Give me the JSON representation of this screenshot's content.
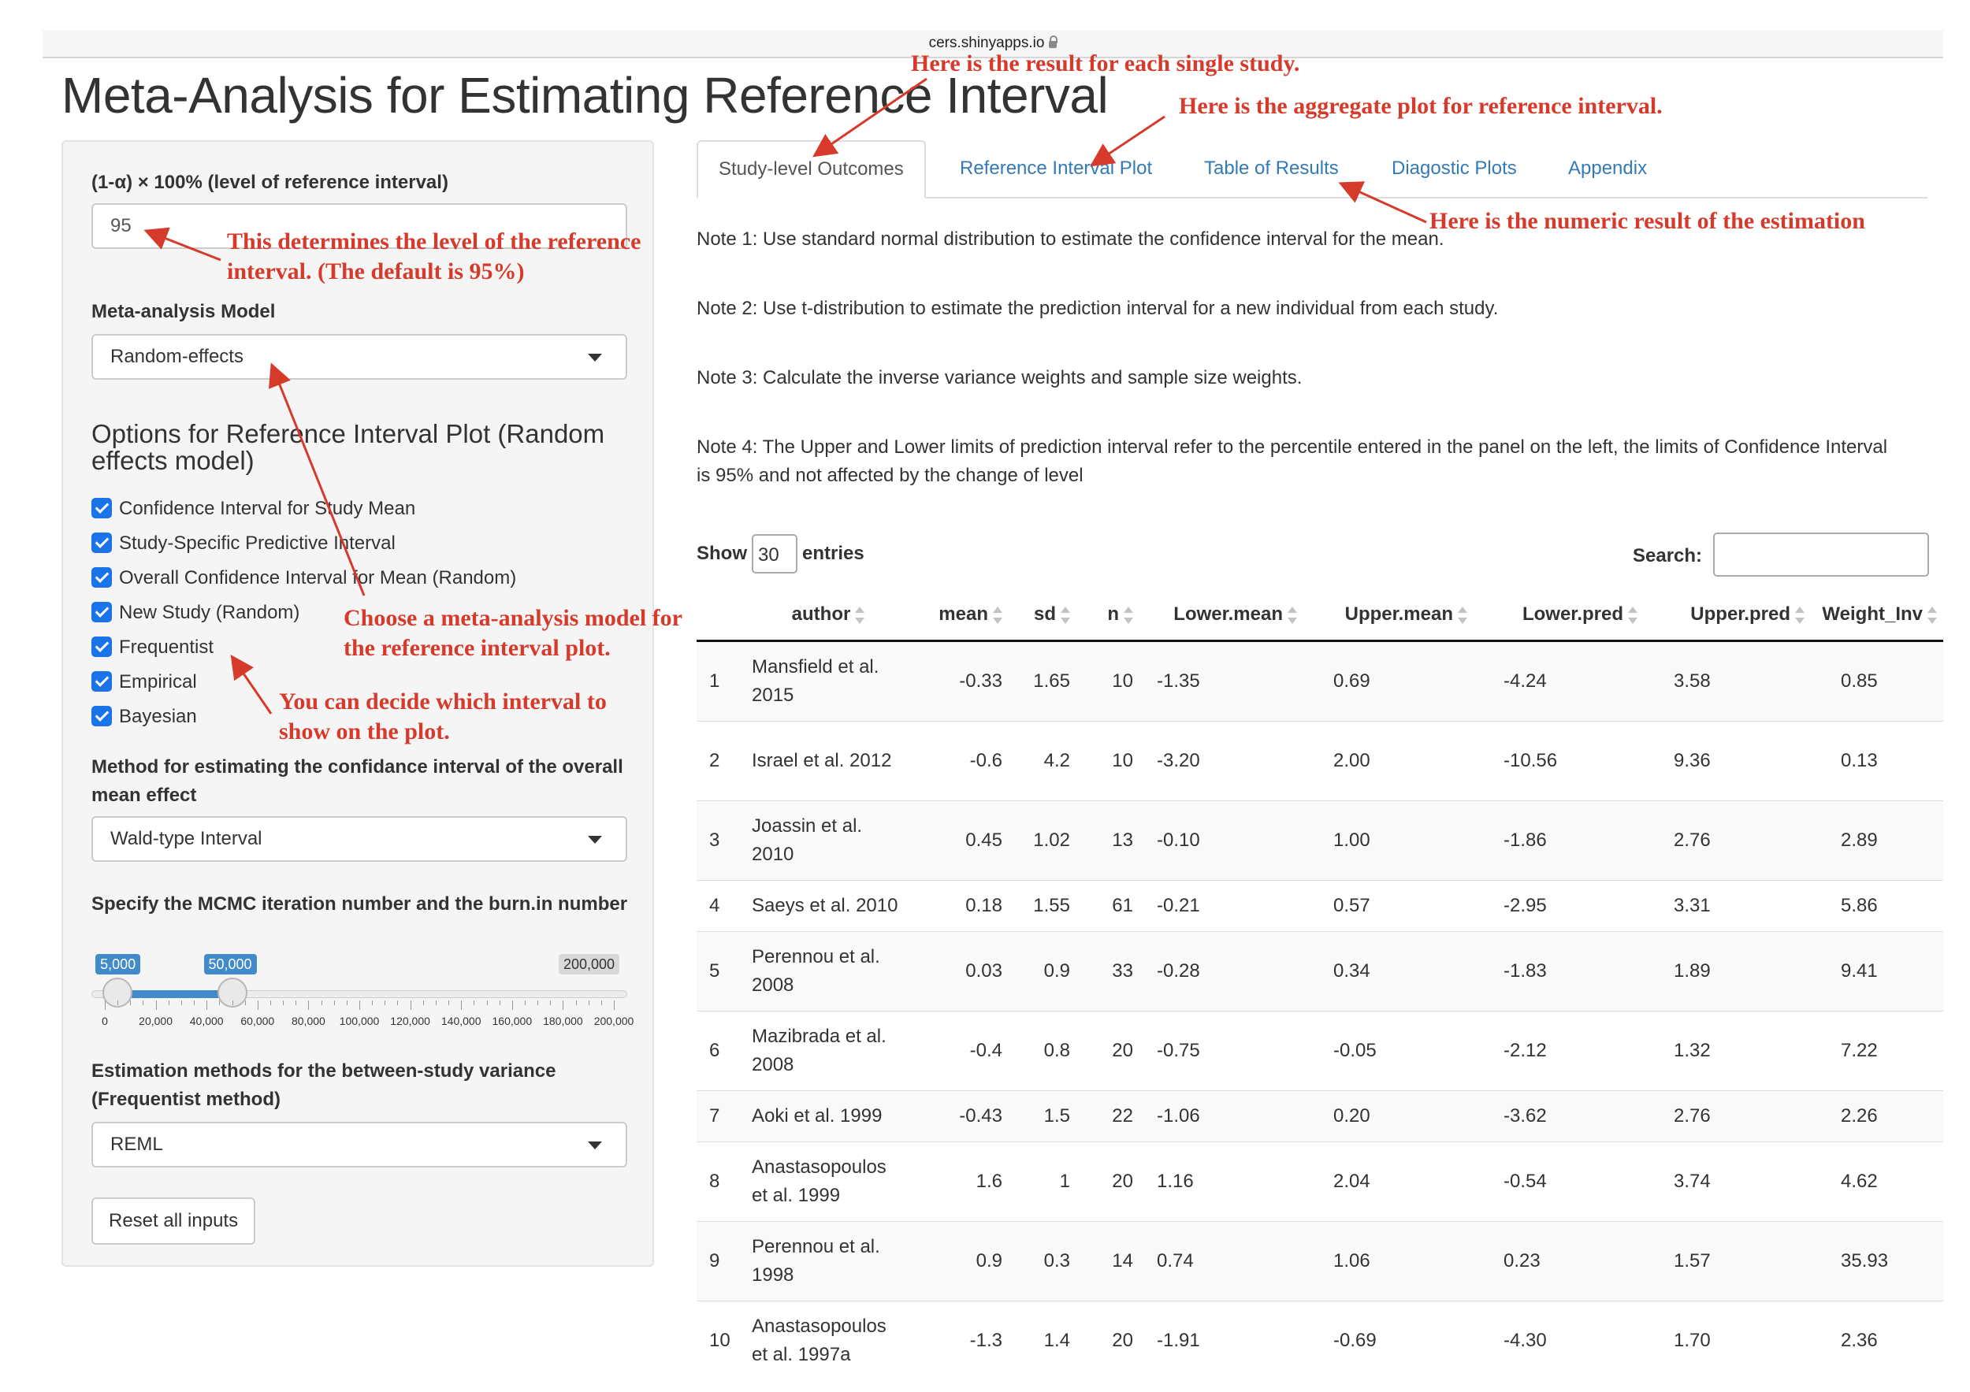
{
  "browser": {
    "url": "cers.shinyapps.io"
  },
  "page_title": "Meta-Analysis for Estimating Reference Interval",
  "sidebar": {
    "level_label": "(1-α) × 100% (level of reference interval)",
    "level_value": "95",
    "model_label": "Meta-analysis Model",
    "model_value": "Random-effects",
    "options_heading": "Options for Reference Interval Plot (Random effects model)",
    "checkboxes": [
      "Confidence Interval for Study Mean",
      "Study-Specific Predictive Interval",
      "Overall Confidence Interval for Mean (Random)",
      "New Study (Random)",
      "Frequentist",
      "Empirical",
      "Bayesian"
    ],
    "method_label": "Method for estimating the confidance interval of the overall mean effect",
    "method_value": "Wald-type Interval",
    "mcmc_label": "Specify the MCMC iteration number and the burn.in number",
    "slider": {
      "min_badge": "5,000",
      "value_badge": "50,000",
      "max_badge": "200,000",
      "low_value": 5000,
      "high_value": 50000,
      "max_value": 200000,
      "ticks": [
        "0",
        "20,000",
        "40,000",
        "60,000",
        "80,000",
        "100,000",
        "120,000",
        "140,000",
        "160,000",
        "180,000",
        "200,000"
      ]
    },
    "variance_label": "Estimation methods for the between-study variance (Frequentist method)",
    "variance_value": "REML",
    "reset_label": "Reset all inputs"
  },
  "tabs": [
    "Study-level Outcomes",
    "Reference Interval Plot",
    "Table of Results",
    "Diagostic Plots",
    "Appendix"
  ],
  "notes": [
    "Note 1: Use standard normal distribution to estimate the confidence interval for the mean.",
    "Note 2: Use t-distribution to estimate the prediction interval for a new individual from each study.",
    "Note 3: Calculate the inverse variance weights and sample size weights.",
    "Note 4: The Upper and Lower limits of prediction interval refer to the percentile entered in the panel on the left, the limits of Confidence Interval is 95% and not affected by the change of level"
  ],
  "table": {
    "show_label": "Show",
    "entries_value": "30",
    "entries_label": "entries",
    "search_label": "Search:",
    "columns": [
      "author",
      "mean",
      "sd",
      "n",
      "Lower.mean",
      "Upper.mean",
      "Lower.pred",
      "Upper.pred",
      "Weight_Inv"
    ],
    "rows": [
      {
        "idx": "1",
        "author": "Mansfield et al. 2015",
        "mean": "-0.33",
        "sd": "1.65",
        "n": "10",
        "lower_mean": "-1.35",
        "upper_mean": "0.69",
        "lower_pred": "-4.24",
        "upper_pred": "3.58",
        "weight": "0.85"
      },
      {
        "idx": "2",
        "author": "Israel et al. 2012",
        "mean": "-0.6",
        "sd": "4.2",
        "n": "10",
        "lower_mean": "-3.20",
        "upper_mean": "2.00",
        "lower_pred": "-10.56",
        "upper_pred": "9.36",
        "weight": "0.13"
      },
      {
        "idx": "3",
        "author": "Joassin et al. 2010",
        "mean": "0.45",
        "sd": "1.02",
        "n": "13",
        "lower_mean": "-0.10",
        "upper_mean": "1.00",
        "lower_pred": "-1.86",
        "upper_pred": "2.76",
        "weight": "2.89"
      },
      {
        "idx": "4",
        "author": "Saeys et al. 2010",
        "mean": "0.18",
        "sd": "1.55",
        "n": "61",
        "lower_mean": "-0.21",
        "upper_mean": "0.57",
        "lower_pred": "-2.95",
        "upper_pred": "3.31",
        "weight": "5.86"
      },
      {
        "idx": "5",
        "author": "Perennou et al. 2008",
        "mean": "0.03",
        "sd": "0.9",
        "n": "33",
        "lower_mean": "-0.28",
        "upper_mean": "0.34",
        "lower_pred": "-1.83",
        "upper_pred": "1.89",
        "weight": "9.41"
      },
      {
        "idx": "6",
        "author": "Mazibrada et al. 2008",
        "mean": "-0.4",
        "sd": "0.8",
        "n": "20",
        "lower_mean": "-0.75",
        "upper_mean": "-0.05",
        "lower_pred": "-2.12",
        "upper_pred": "1.32",
        "weight": "7.22"
      },
      {
        "idx": "7",
        "author": "Aoki et al. 1999",
        "mean": "-0.43",
        "sd": "1.5",
        "n": "22",
        "lower_mean": "-1.06",
        "upper_mean": "0.20",
        "lower_pred": "-3.62",
        "upper_pred": "2.76",
        "weight": "2.26"
      },
      {
        "idx": "8",
        "author": "Anastasopoulos et al. 1999",
        "mean": "1.6",
        "sd": "1",
        "n": "20",
        "lower_mean": "1.16",
        "upper_mean": "2.04",
        "lower_pred": "-0.54",
        "upper_pred": "3.74",
        "weight": "4.62"
      },
      {
        "idx": "9",
        "author": "Perennou et al. 1998",
        "mean": "0.9",
        "sd": "0.3",
        "n": "14",
        "lower_mean": "0.74",
        "upper_mean": "1.06",
        "lower_pred": "0.23",
        "upper_pred": "1.57",
        "weight": "35.93"
      },
      {
        "idx": "10",
        "author": "Anastasopoulos et al. 1997a",
        "mean": "-1.3",
        "sd": "1.4",
        "n": "20",
        "lower_mean": "-1.91",
        "upper_mean": "-0.69",
        "lower_pred": "-4.30",
        "upper_pred": "1.70",
        "weight": "2.36"
      }
    ]
  },
  "annotations": {
    "single_study": "Here is the result for each single study.",
    "aggregate_plot": "Here is the aggregate plot for reference interval.",
    "numeric_result": "Here is the numeric result of the estimation",
    "level_line1": "This determines the level of the reference",
    "level_line2": "interval. (The default is 95%)",
    "model_line1": "Choose a meta-analysis model for",
    "model_line2": "the reference interval plot.",
    "interval_line1": "You can decide which interval to",
    "interval_line2": "show on the plot."
  },
  "colors": {
    "annotation": "#d63a2a",
    "link": "#337ab7",
    "checkbox": "#1a73e8",
    "slider": "#428bca"
  }
}
